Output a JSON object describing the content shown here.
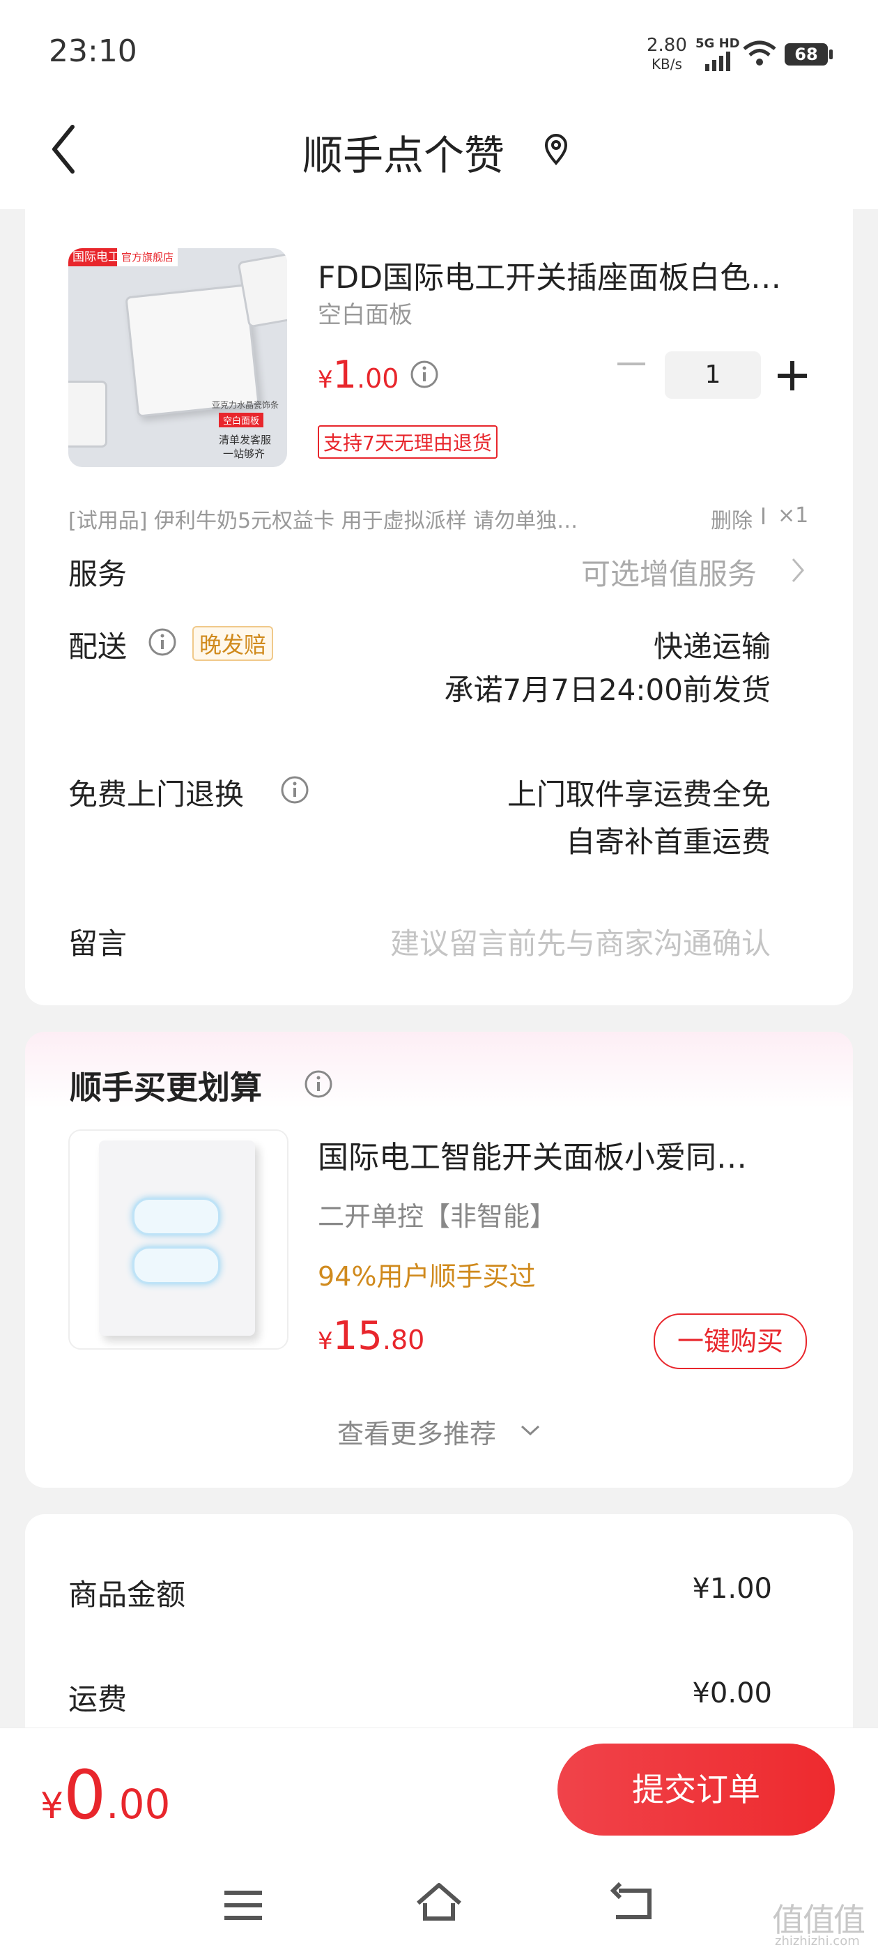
{
  "status_bar": {
    "time": "23:10",
    "net_speed_value": "2.80",
    "net_speed_unit": "KB/s",
    "network": "5G HD",
    "battery": "68"
  },
  "header": {
    "title": "顺手点个赞"
  },
  "product": {
    "thumb_tag_brand": "国际电工",
    "thumb_tag_store": "官方旗舰店",
    "thumb_caption_1": "亚克力水晶瓷饰条",
    "thumb_caption_2": "空白面板",
    "thumb_caption_3": "清单发客服",
    "thumb_caption_4": "一站够齐",
    "title": "FDD国际电工开关插座面板白色…",
    "variant": "空白面板",
    "price_symbol": "¥",
    "price_int": "1",
    "price_dec": ".00",
    "quantity": "1",
    "return_badge": "支持7天无理由退货"
  },
  "trial": {
    "text": "[试用品]   伊利牛奶5元权益卡 用于虚拟派样 请勿单独…",
    "delete": "删除",
    "count": "×1"
  },
  "rows": {
    "service_label": "服务",
    "service_value": "可选增值服务",
    "delivery_label": "配送",
    "delivery_badge": "晚发赔",
    "delivery_value_1": "快递运输",
    "delivery_value_2": "承诺7月7日24:00前发货",
    "return_label": "免费上门退换",
    "return_value_1": "上门取件享运费全免",
    "return_value_2": "自寄补首重运费",
    "message_label": "留言",
    "message_placeholder": "建议留言前先与商家沟通确认"
  },
  "recommend": {
    "section_title": "顺手买更划算",
    "title": "国际电工智能开关面板小爱同…",
    "variant": "二开单控【非智能】",
    "stat": "94%用户顺手买过",
    "price_symbol": "¥",
    "price_int": "15",
    "price_dec": ".80",
    "buy_button": "一键购买",
    "more": "查看更多推荐"
  },
  "summary": {
    "goods_label": "商品金额",
    "goods_value": "¥1.00",
    "shipping_label": "运费",
    "shipping_value": "¥0.00"
  },
  "footer": {
    "total_symbol": "¥",
    "total_int": "0",
    "total_dec": ".00",
    "submit": "提交订单"
  },
  "watermark": {
    "text": "值值值",
    "domain": "zhizhizhi.com"
  },
  "colors": {
    "accent": "#e8262c",
    "gold": "#d08a1d"
  }
}
